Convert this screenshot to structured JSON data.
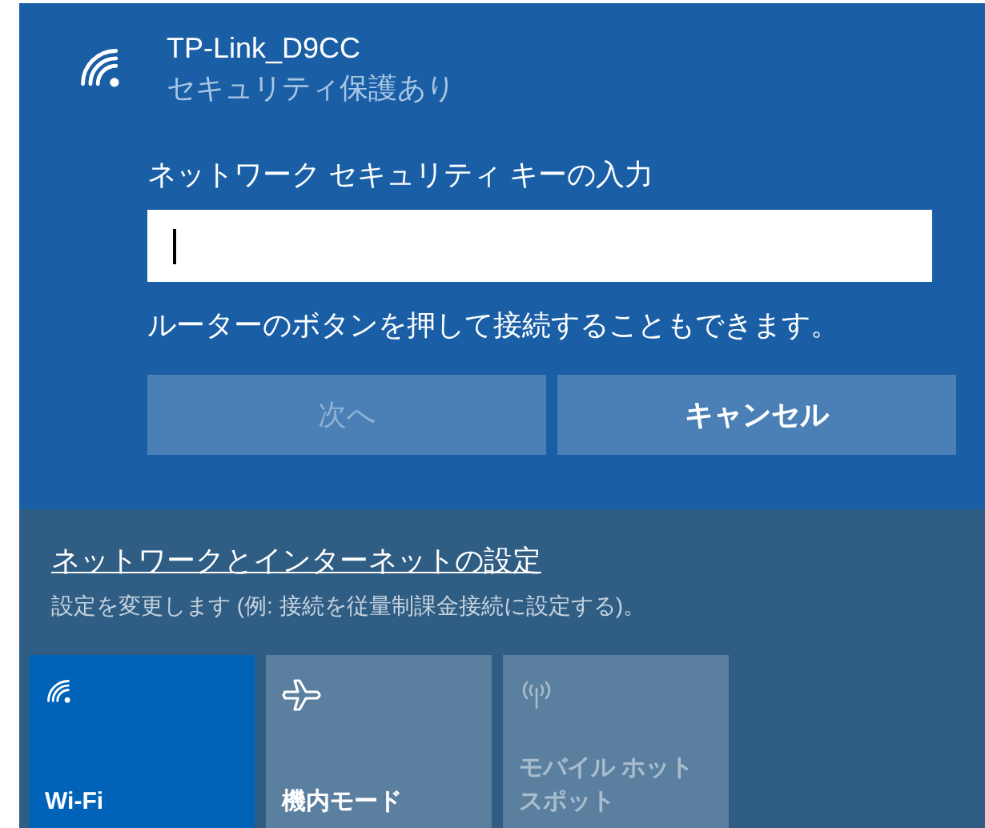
{
  "network": {
    "name": "TP-Link_D9CC",
    "status": "セキュリティ保護あり"
  },
  "key_field": {
    "label": "ネットワーク セキュリティ キーの入力",
    "focused": true
  },
  "hint": "ルーターのボタンを押して接続することもできます。",
  "buttons": [
    {
      "label": "次へ",
      "disabled": true
    },
    {
      "label": "キャンセル",
      "disabled": false
    }
  ],
  "settings": {
    "link": "ネットワークとインターネットの設定",
    "description": "設定を変更します (例: 接続を従量制課金接続に設定する)。"
  },
  "tiles": [
    {
      "kind": "wifi",
      "label": "Wi-Fi",
      "selected": true,
      "disabled": false
    },
    {
      "kind": "airplane",
      "label": "機内モード",
      "selected": false,
      "disabled": false
    },
    {
      "kind": "hotspot",
      "label": "モバイル ホットスポット",
      "selected": false,
      "disabled": true
    }
  ]
}
